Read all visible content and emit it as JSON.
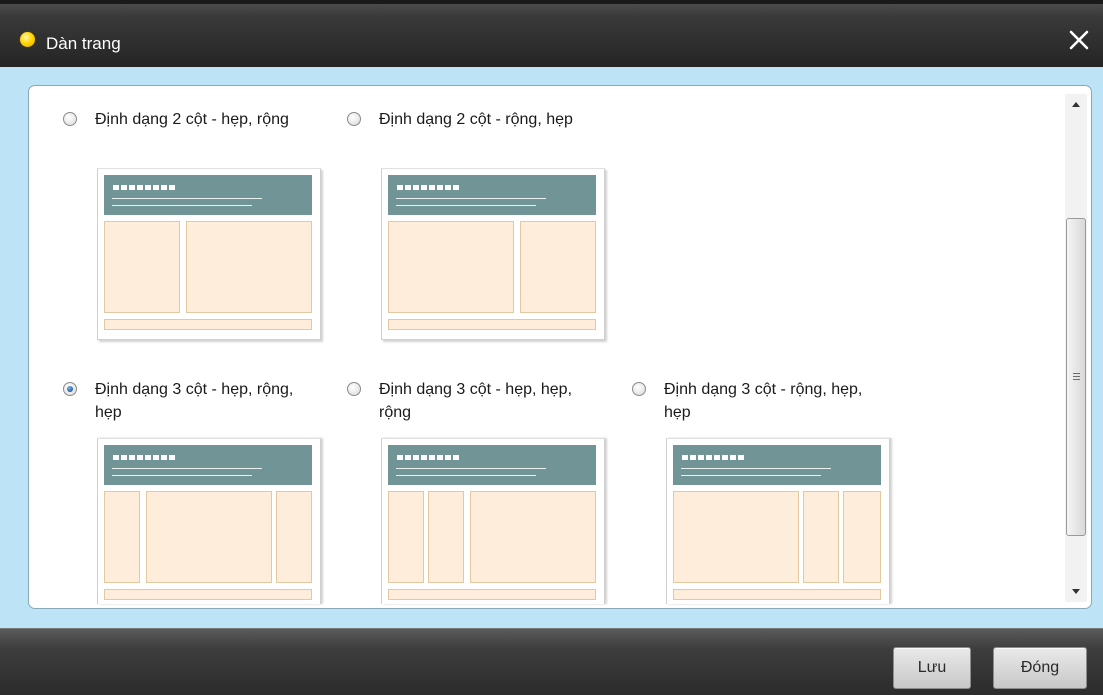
{
  "dialog": {
    "title": "Dàn trang",
    "close_icon": "close-icon",
    "status_dot_color": "#ffd700"
  },
  "layouts": [
    {
      "id": "2col-narrow-wide",
      "label": "Định dạng 2 cột - hẹp, rộng",
      "selected": false
    },
    {
      "id": "2col-wide-narrow",
      "label": "Định dạng 2 cột - rộng, hẹp",
      "selected": false
    },
    {
      "id": "3col-narrow-wide-narrow",
      "label": "Định dạng 3 cột - hẹp, rộng, hẹp",
      "selected": true
    },
    {
      "id": "3col-narrow-narrow-wide",
      "label": "Định dạng 3 cột - hẹp, hẹp, rộng",
      "selected": false
    },
    {
      "id": "3col-wide-narrow-narrow",
      "label": "Định dạng 3 cột - rộng, hẹp, hẹp",
      "selected": false
    }
  ],
  "buttons": {
    "save_label": "Lưu",
    "close_label": "Đóng"
  },
  "colors": {
    "header_band": "#719596",
    "column_fill": "#fdedda",
    "column_border": "#e2c99f",
    "body_background": "#bde4f6"
  }
}
